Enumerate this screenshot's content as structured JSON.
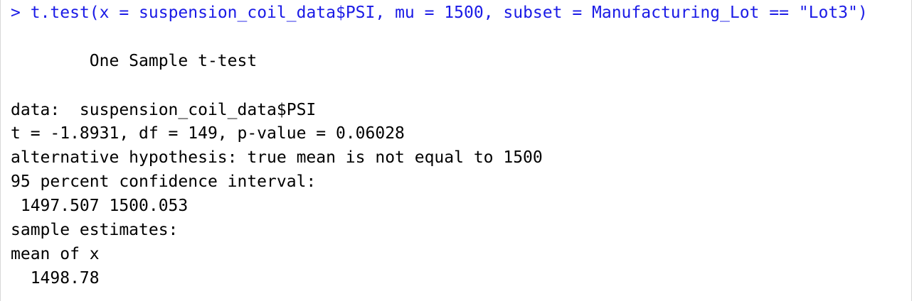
{
  "console": {
    "prompt": ">",
    "command": "t.test(x = suspension_coil_data$PSI, mu = 1500, subset = Manufacturing_Lot == \"Lot3\")",
    "output": {
      "title": "        One Sample t-test",
      "data_line": "data:  suspension_coil_data$PSI",
      "stats_line": "t = -1.8931, df = 149, p-value = 0.06028",
      "alt_hypothesis": "alternative hypothesis: true mean is not equal to 1500",
      "ci_label": "95 percent confidence interval:",
      "ci_values": " 1497.507 1500.053",
      "estimates_label": "sample estimates:",
      "mean_label": "mean of x",
      "mean_value": "  1498.78"
    },
    "colors": {
      "command": "#1a1ae6",
      "output": "#000000",
      "background": "#ffffff"
    }
  }
}
